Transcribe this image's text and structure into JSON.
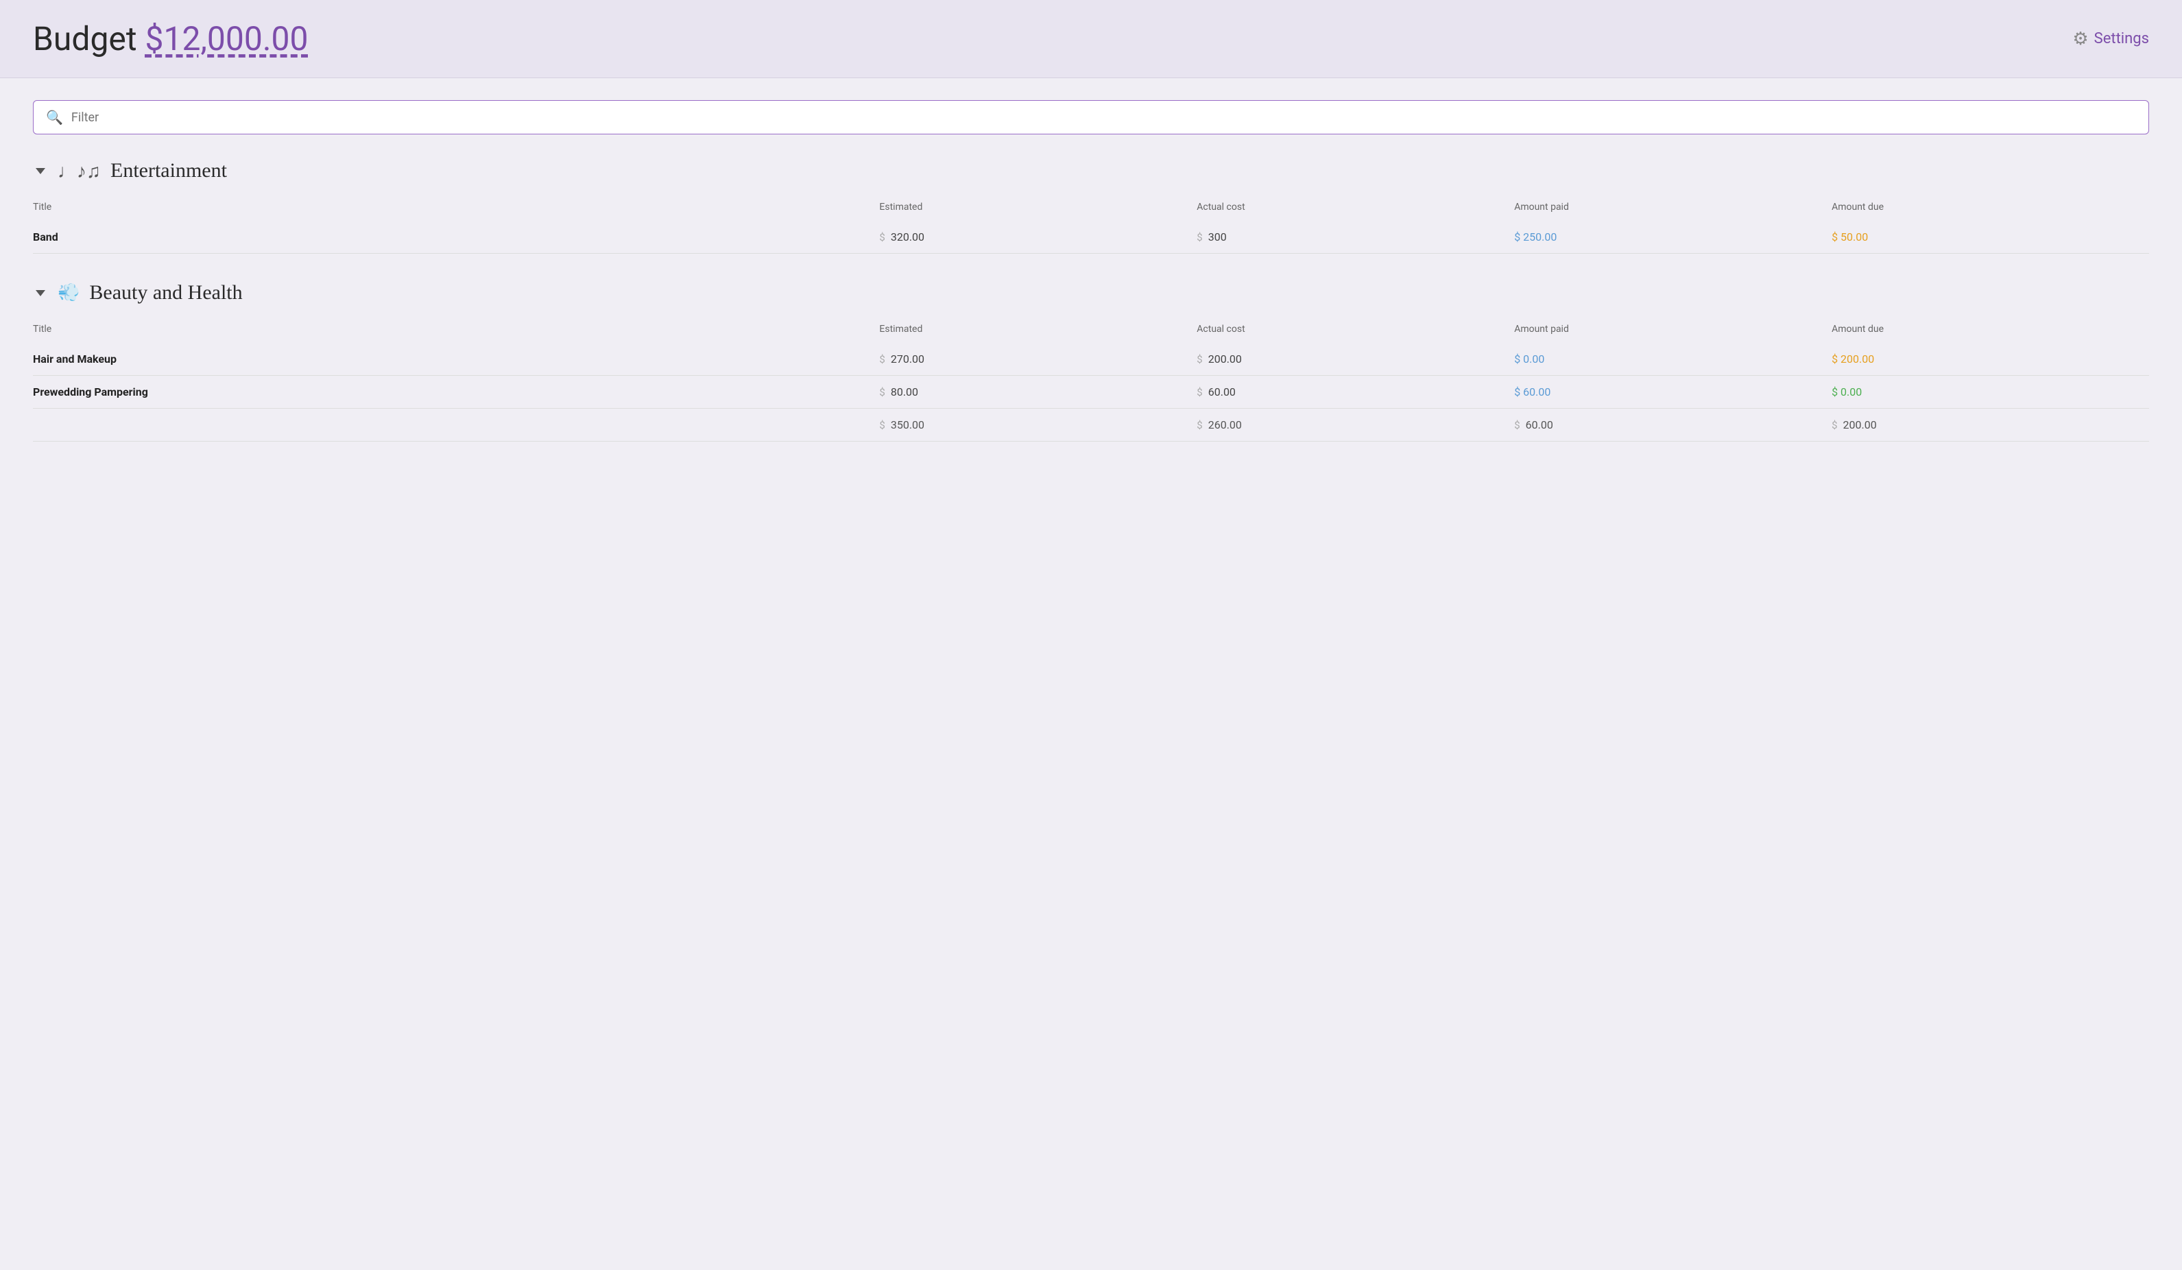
{
  "header": {
    "budget_label": "Budget",
    "budget_amount": "$12,000.00",
    "settings_label": "Settings"
  },
  "filter": {
    "placeholder": "Filter"
  },
  "categories": [
    {
      "id": "entertainment",
      "icon": "♩♪♫",
      "title": "Entertainment",
      "columns": [
        "Title",
        "Estimated",
        "Actual cost",
        "Amount paid",
        "Amount due"
      ],
      "items": [
        {
          "title": "Band",
          "estimated": "320.00",
          "actual_cost": "300",
          "amount_paid": "250.00",
          "amount_due": "50.00",
          "paid_color": "blue",
          "due_color": "orange"
        }
      ]
    },
    {
      "id": "beauty-health",
      "icon": "💨",
      "title": "Beauty and Health",
      "columns": [
        "Title",
        "Estimated",
        "Actual cost",
        "Amount paid",
        "Amount due"
      ],
      "items": [
        {
          "title": "Hair and Makeup",
          "estimated": "270.00",
          "actual_cost": "200.00",
          "amount_paid": "0.00",
          "amount_due": "200.00",
          "paid_color": "blue",
          "due_color": "orange"
        },
        {
          "title": "Prewedding Pampering",
          "estimated": "80.00",
          "actual_cost": "60.00",
          "amount_paid": "60.00",
          "amount_due": "0.00",
          "paid_color": "blue",
          "due_color": "green"
        }
      ],
      "summary": {
        "estimated": "350.00",
        "actual_cost": "260.00",
        "amount_paid": "60.00",
        "amount_due": "200.00"
      }
    }
  ]
}
